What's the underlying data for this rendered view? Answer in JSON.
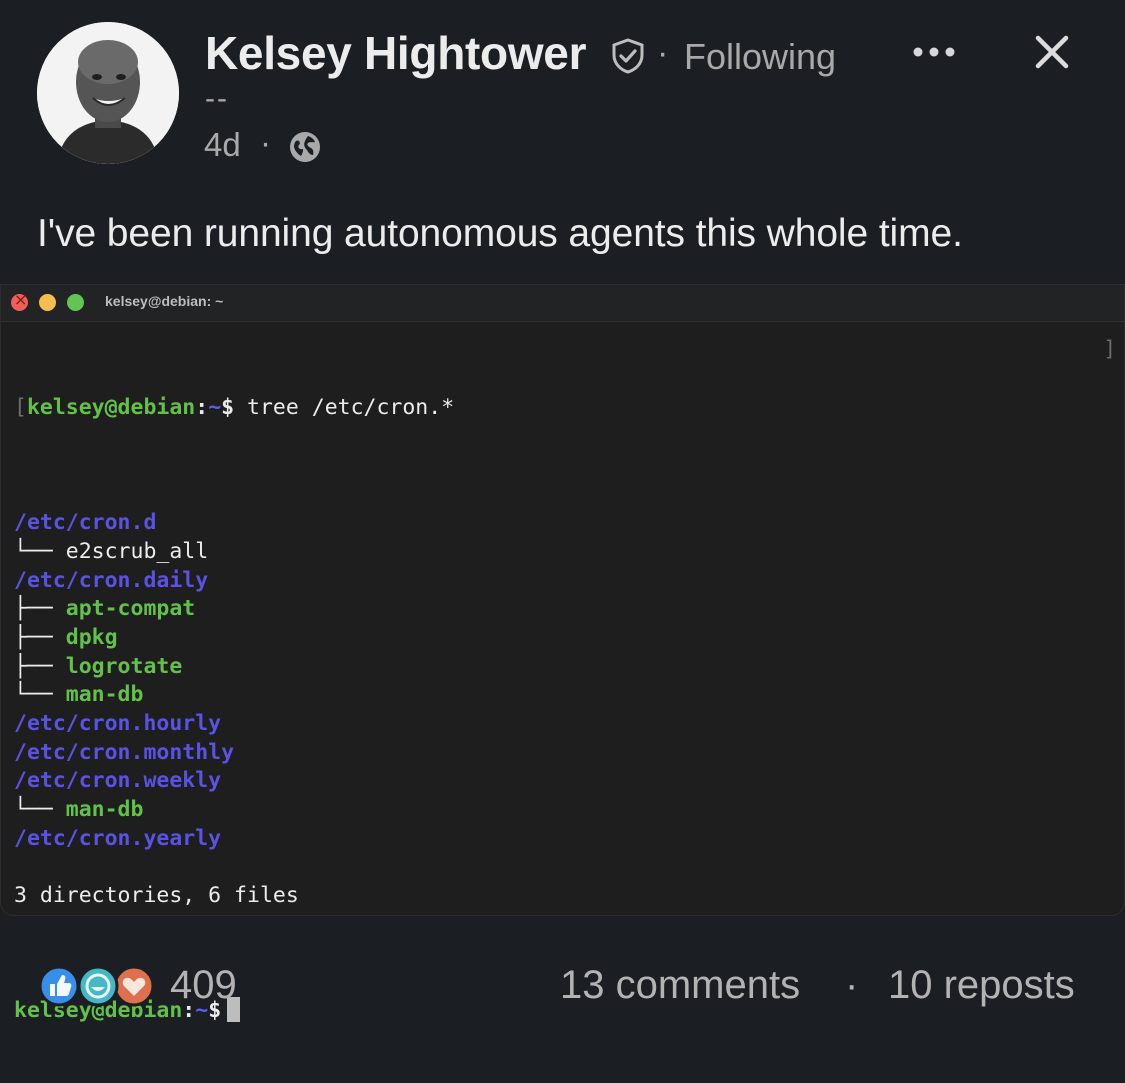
{
  "author": {
    "name": "Kelsey Hightower",
    "separator": "·",
    "follow_status": "Following",
    "headline": "--",
    "timestamp": "4d",
    "time_separator": "·"
  },
  "icons": {
    "verified": "verified-shield-icon",
    "more": "more-options-icon",
    "close": "close-icon",
    "visibility": "globe-icon",
    "reactions": [
      "like-icon",
      "funny-icon",
      "love-icon"
    ]
  },
  "post": {
    "text": "I've been running autonomous agents this whole time."
  },
  "terminal": {
    "title": "kelsey@debian: ~",
    "prompt_user": "kelsey@debian",
    "prompt_sep": ":",
    "prompt_path": "~",
    "prompt_sym": "$",
    "command": " tree /etc/cron.*",
    "lines": [
      {
        "type": "dir",
        "gl": "",
        "text": "/etc/cron.d"
      },
      {
        "type": "file",
        "gl": "└── ",
        "text": "e2scrub_all"
      },
      {
        "type": "dir",
        "gl": "",
        "text": "/etc/cron.daily"
      },
      {
        "type": "exe",
        "gl": "├── ",
        "text": "apt-compat"
      },
      {
        "type": "exe",
        "gl": "├── ",
        "text": "dpkg"
      },
      {
        "type": "exe",
        "gl": "├── ",
        "text": "logrotate"
      },
      {
        "type": "exe",
        "gl": "└── ",
        "text": "man-db"
      },
      {
        "type": "dir",
        "gl": "",
        "text": "/etc/cron.hourly"
      },
      {
        "type": "dir",
        "gl": "",
        "text": "/etc/cron.monthly"
      },
      {
        "type": "dir",
        "gl": "",
        "text": "/etc/cron.weekly"
      },
      {
        "type": "exe",
        "gl": "└── ",
        "text": "man-db"
      },
      {
        "type": "dir",
        "gl": "",
        "text": "/etc/cron.yearly"
      },
      {
        "type": "blank",
        "gl": "",
        "text": ""
      },
      {
        "type": "plain",
        "gl": "",
        "text": "3 directories, 6 files"
      }
    ]
  },
  "social": {
    "reaction_count": "409",
    "comments": "13 comments",
    "separator": "·",
    "reposts": "10 reposts"
  },
  "colors": {
    "background": "#1b1f23",
    "terminal_bg": "#1e1e1e",
    "prompt_green": "#62c148",
    "dir_blue": "#5a52e4",
    "like_blue": "#378fe9",
    "funny_teal": "#44b8c4",
    "love_orange": "#df704d"
  }
}
